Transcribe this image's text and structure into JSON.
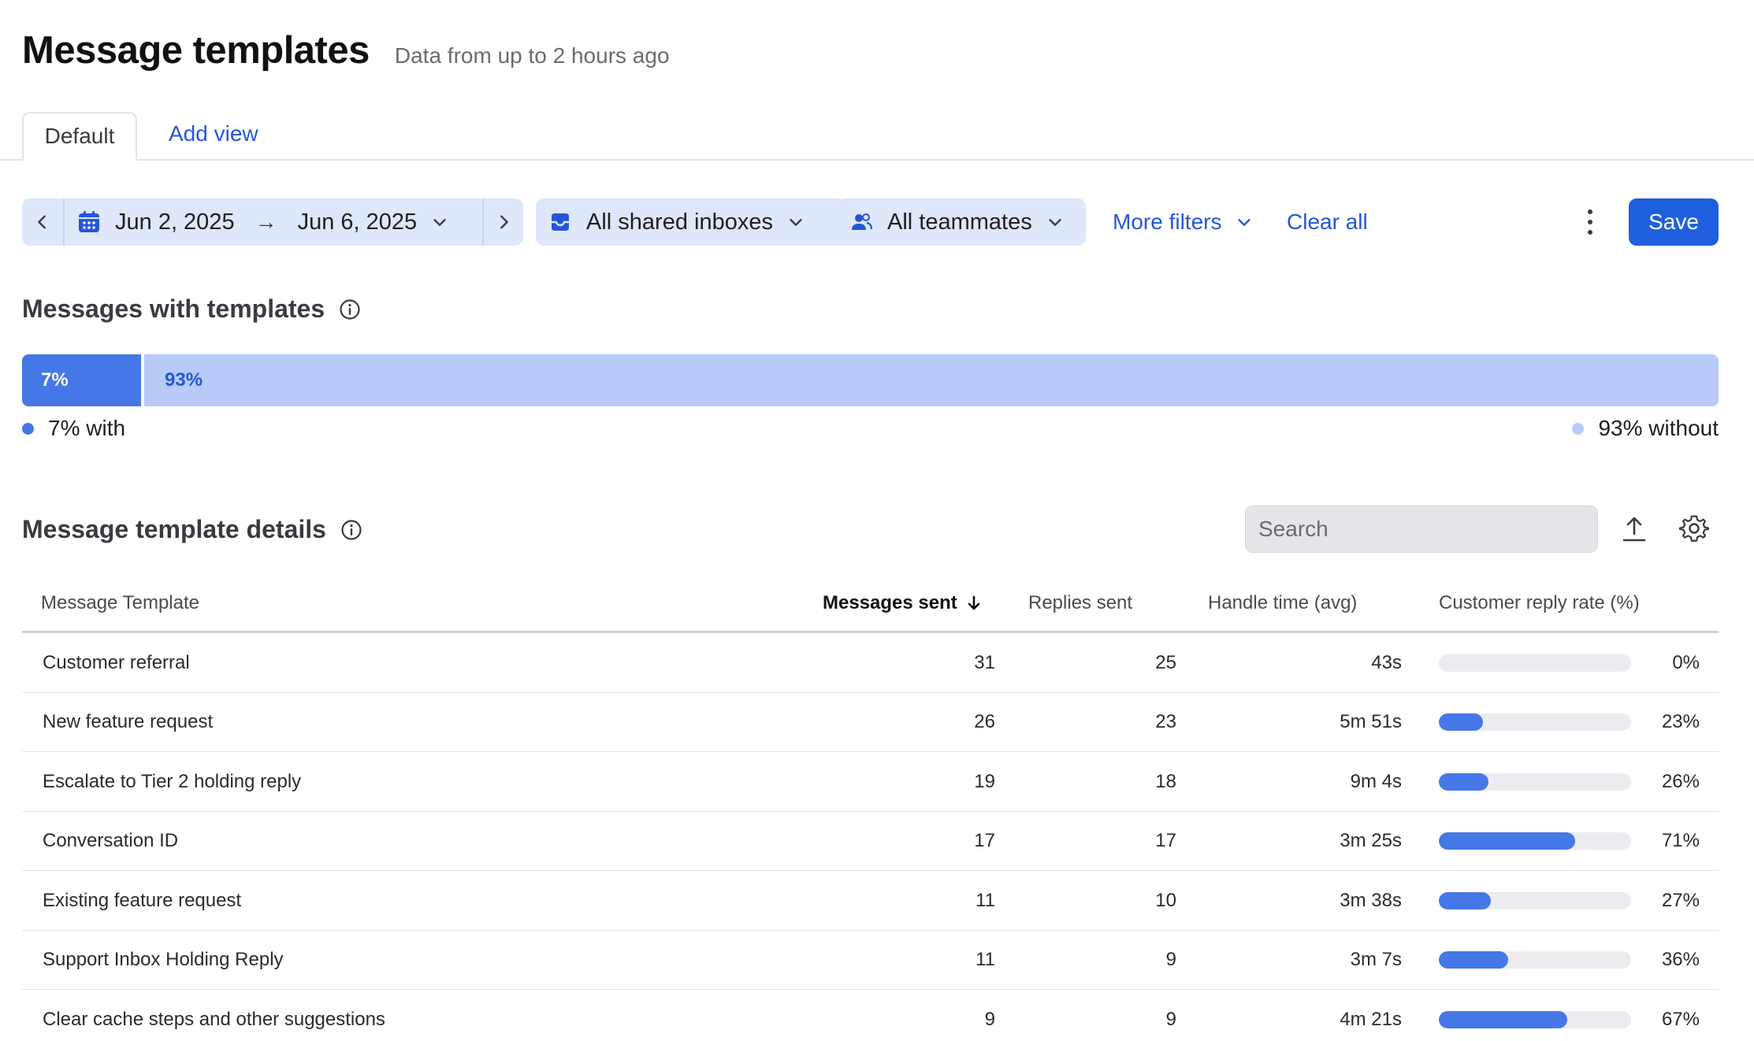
{
  "header": {
    "title": "Message templates",
    "subtitle": "Data from up to 2 hours ago"
  },
  "tabs": {
    "default_label": "Default",
    "add_view_label": "Add view"
  },
  "filters": {
    "date_start": "Jun 2, 2025",
    "date_arrow": "→",
    "date_end": "Jun 6, 2025",
    "inboxes_label": "All shared inboxes",
    "teammates_label": "All teammates",
    "more_filters_label": "More filters",
    "clear_all_label": "Clear all",
    "save_label": "Save"
  },
  "summary": {
    "title": "Messages with templates",
    "with_segment_label": "7%",
    "without_segment_label": "93%",
    "with_fraction": 0.07,
    "legend_with": "7% with",
    "legend_without": "93% without",
    "color_with": "#4578e6",
    "color_without": "#b9caf9"
  },
  "details": {
    "title": "Message template details",
    "search_placeholder": "Search",
    "columns": {
      "name": "Message Template",
      "sent": "Messages sent",
      "replies": "Replies sent",
      "handle": "Handle time (avg)",
      "rate": "Customer reply rate (%)"
    },
    "rows": [
      {
        "name": "Customer referral",
        "sent": "31",
        "replies": "25",
        "handle": "43s",
        "rate": "0%",
        "rate_value": 0
      },
      {
        "name": "New feature request",
        "sent": "26",
        "replies": "23",
        "handle": "5m 51s",
        "rate": "23%",
        "rate_value": 23
      },
      {
        "name": "Escalate to Tier 2 holding reply",
        "sent": "19",
        "replies": "18",
        "handle": "9m 4s",
        "rate": "26%",
        "rate_value": 26
      },
      {
        "name": "Conversation ID",
        "sent": "17",
        "replies": "17",
        "handle": "3m 25s",
        "rate": "71%",
        "rate_value": 71
      },
      {
        "name": "Existing feature request",
        "sent": "11",
        "replies": "10",
        "handle": "3m 38s",
        "rate": "27%",
        "rate_value": 27
      },
      {
        "name": "Support Inbox Holding Reply",
        "sent": "11",
        "replies": "9",
        "handle": "3m 7s",
        "rate": "36%",
        "rate_value": 36
      },
      {
        "name": "Clear cache steps and other suggestions",
        "sent": "9",
        "replies": "9",
        "handle": "4m 21s",
        "rate": "67%",
        "rate_value": 67
      }
    ]
  },
  "colors": {
    "accent": "#1f5fde",
    "link": "#2457d6",
    "pill_bg": "#dfe7fb"
  }
}
